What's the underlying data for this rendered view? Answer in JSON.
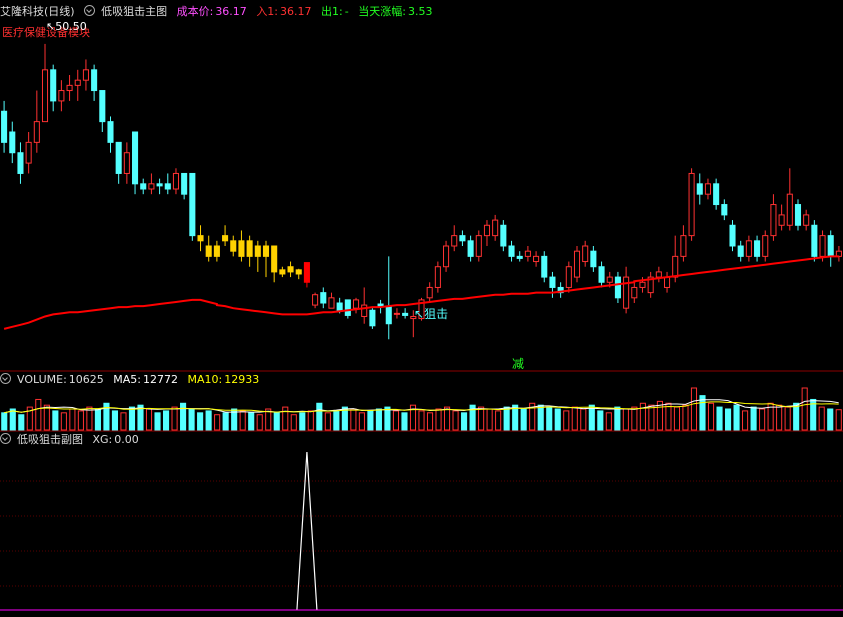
{
  "main_header": {
    "stock_name": "艾隆科技",
    "period": "(日线)",
    "indicator": "低吸狙击主图",
    "cost_label": "成本价:",
    "cost_value": "36.17",
    "in_label": "入1:",
    "in_value": "36.17",
    "out_label": "出1:",
    "out_value": "-",
    "change_label": "当天涨幅:",
    "change_value": "3.53"
  },
  "sector_label": "医疗保健设备模块",
  "high_marker": "50.50",
  "signal_label": "狙击",
  "reduce_label": "减",
  "volume_header": {
    "name": "VOLUME:",
    "value": "10625",
    "ma5_label": "MA5:",
    "ma5": "12772",
    "ma10_label": "MA10:",
    "ma10": "12933"
  },
  "sub_header": {
    "name": "低吸狙击副图",
    "xg_label": "XG:",
    "xg_value": "0.00"
  },
  "colors": {
    "up": "#ff3232",
    "down": "#54ffff",
    "ma_line": "#ff0000",
    "signal_yellow": "#ffd200",
    "signal_bar": "#ff0000",
    "ma5": "#ffffff",
    "ma10": "#ffff00",
    "xg": "#ffffff"
  },
  "chart_data": {
    "type": "candlestick",
    "candles": [
      {
        "o": 44,
        "c": 41,
        "h": 45,
        "l": 40
      },
      {
        "o": 42,
        "c": 40,
        "h": 43,
        "l": 39
      },
      {
        "o": 40,
        "c": 38,
        "h": 41,
        "l": 37
      },
      {
        "o": 39,
        "c": 41,
        "h": 42,
        "l": 38
      },
      {
        "o": 41,
        "c": 43,
        "h": 46,
        "l": 40
      },
      {
        "o": 43,
        "c": 48,
        "h": 50.5,
        "l": 43
      },
      {
        "o": 48,
        "c": 45,
        "h": 48.5,
        "l": 44
      },
      {
        "o": 45,
        "c": 46,
        "h": 47,
        "l": 44
      },
      {
        "o": 46,
        "c": 46.5,
        "h": 47.5,
        "l": 45
      },
      {
        "o": 46.5,
        "c": 47,
        "h": 48,
        "l": 45
      },
      {
        "o": 47,
        "c": 48,
        "h": 49,
        "l": 46
      },
      {
        "o": 48,
        "c": 46,
        "h": 48.5,
        "l": 45
      },
      {
        "o": 46,
        "c": 43,
        "h": 46,
        "l": 42
      },
      {
        "o": 43,
        "c": 41,
        "h": 43.5,
        "l": 40
      },
      {
        "o": 41,
        "c": 38,
        "h": 41,
        "l": 37
      },
      {
        "o": 38,
        "c": 40,
        "h": 41,
        "l": 37
      },
      {
        "o": 42,
        "c": 37,
        "h": 42,
        "l": 36
      },
      {
        "o": 37,
        "c": 36.5,
        "h": 37.5,
        "l": 36
      },
      {
        "o": 36.5,
        "c": 37,
        "h": 38,
        "l": 36
      },
      {
        "o": 37,
        "c": 36.8,
        "h": 37.5,
        "l": 36
      },
      {
        "o": 37,
        "c": 36.5,
        "h": 38,
        "l": 36
      },
      {
        "o": 36.5,
        "c": 38,
        "h": 38.5,
        "l": 36
      },
      {
        "o": 38,
        "c": 36,
        "h": 38,
        "l": 35.5
      },
      {
        "o": 38,
        "c": 32,
        "h": 38,
        "l": 31.5
      },
      {
        "o": 32,
        "c": 31.5,
        "h": 33,
        "l": 30.5
      },
      {
        "o": 31,
        "c": 30,
        "h": 32,
        "l": 29.5
      },
      {
        "o": 30,
        "c": 31,
        "h": 31.5,
        "l": 29.5
      },
      {
        "o": 32,
        "c": 31.5,
        "h": 33,
        "l": 31
      },
      {
        "o": 31.5,
        "c": 30.5,
        "h": 32,
        "l": 30
      },
      {
        "o": 30,
        "c": 31.5,
        "h": 32.5,
        "l": 29.5
      },
      {
        "o": 31.5,
        "c": 30,
        "h": 32,
        "l": 29
      },
      {
        "o": 30,
        "c": 31,
        "h": 31.5,
        "l": 28.5
      },
      {
        "o": 30,
        "c": 31,
        "h": 31.5,
        "l": 28
      },
      {
        "o": 31,
        "c": 28.5,
        "h": 31,
        "l": 27.5
      },
      {
        "o": 28.3,
        "c": 28.7,
        "h": 29,
        "l": 28
      },
      {
        "o": 28.5,
        "c": 29,
        "h": 29.5,
        "l": 28
      },
      {
        "o": 28.7,
        "c": 28.3,
        "h": 28.8,
        "l": 27.8
      },
      {
        "o": 27.5,
        "c": 29.4,
        "h": 29.4,
        "l": 27
      },
      {
        "o": 25.3,
        "c": 26.3,
        "h": 26.5,
        "l": 25
      },
      {
        "o": 26.5,
        "c": 25.5,
        "h": 27,
        "l": 25
      },
      {
        "o": 25,
        "c": 26,
        "h": 26.5,
        "l": 25
      },
      {
        "o": 25.5,
        "c": 24.7,
        "h": 26,
        "l": 24.5
      },
      {
        "o": 25.8,
        "c": 24.3,
        "h": 25.8,
        "l": 24
      },
      {
        "o": 25,
        "c": 25.8,
        "h": 26,
        "l": 24.5
      },
      {
        "o": 24.2,
        "c": 25.3,
        "h": 27,
        "l": 23.5
      },
      {
        "o": 24.8,
        "c": 23.3,
        "h": 25,
        "l": 23
      },
      {
        "o": 25.4,
        "c": 25.2,
        "h": 25.8,
        "l": 24.5
      },
      {
        "o": 25.2,
        "c": 23.5,
        "h": 30,
        "l": 22
      },
      {
        "o": 24.5,
        "c": 24.5,
        "h": 25,
        "l": 24
      },
      {
        "o": 24.5,
        "c": 24.3,
        "h": 25,
        "l": 24
      },
      {
        "o": 24,
        "c": 24.2,
        "h": 24.8,
        "l": 22.2
      },
      {
        "o": 24,
        "c": 25.8,
        "h": 26,
        "l": 23.8
      },
      {
        "o": 26,
        "c": 27,
        "h": 27.5,
        "l": 25.5
      },
      {
        "o": 27,
        "c": 29,
        "h": 29.5,
        "l": 26.5
      },
      {
        "o": 29,
        "c": 31,
        "h": 31.5,
        "l": 28.5
      },
      {
        "o": 31,
        "c": 32,
        "h": 33,
        "l": 30.5
      },
      {
        "o": 32,
        "c": 31.5,
        "h": 32.5,
        "l": 31
      },
      {
        "o": 31.5,
        "c": 30,
        "h": 32,
        "l": 29.5
      },
      {
        "o": 30,
        "c": 32,
        "h": 32.5,
        "l": 29.5
      },
      {
        "o": 32,
        "c": 33,
        "h": 33.5,
        "l": 31
      },
      {
        "o": 32,
        "c": 33.5,
        "h": 34,
        "l": 31.5
      },
      {
        "o": 33,
        "c": 31,
        "h": 33.5,
        "l": 30.5
      },
      {
        "o": 31,
        "c": 30,
        "h": 31.5,
        "l": 29.5
      },
      {
        "o": 30,
        "c": 29.8,
        "h": 30.5,
        "l": 29.5
      },
      {
        "o": 30,
        "c": 30.5,
        "h": 31,
        "l": 29.5
      },
      {
        "o": 29.5,
        "c": 30,
        "h": 30.5,
        "l": 29
      },
      {
        "o": 30,
        "c": 28,
        "h": 30.5,
        "l": 27.5
      },
      {
        "o": 28,
        "c": 27,
        "h": 28.5,
        "l": 26
      },
      {
        "o": 27,
        "c": 26.5,
        "h": 27.5,
        "l": 26
      },
      {
        "o": 27,
        "c": 29,
        "h": 29.5,
        "l": 26.5
      },
      {
        "o": 28,
        "c": 30.5,
        "h": 31,
        "l": 27.5
      },
      {
        "o": 29.5,
        "c": 31,
        "h": 31.5,
        "l": 29
      },
      {
        "o": 30.5,
        "c": 29,
        "h": 31,
        "l": 28.5
      },
      {
        "o": 29,
        "c": 27.5,
        "h": 29.5,
        "l": 27
      },
      {
        "o": 27.5,
        "c": 28,
        "h": 28.5,
        "l": 27
      },
      {
        "o": 28,
        "c": 26,
        "h": 28.5,
        "l": 25.5
      },
      {
        "o": 25,
        "c": 28,
        "h": 29,
        "l": 24.5
      },
      {
        "o": 26,
        "c": 27,
        "h": 27.5,
        "l": 25.5
      },
      {
        "o": 27,
        "c": 27.5,
        "h": 28,
        "l": 26.5
      },
      {
        "o": 26.5,
        "c": 28,
        "h": 28.5,
        "l": 26
      },
      {
        "o": 28,
        "c": 28.5,
        "h": 29,
        "l": 27.5
      },
      {
        "o": 27,
        "c": 28,
        "h": 28.5,
        "l": 26.5
      },
      {
        "o": 28,
        "c": 30,
        "h": 32,
        "l": 27.5
      },
      {
        "o": 30,
        "c": 32,
        "h": 33,
        "l": 29.5
      },
      {
        "o": 32,
        "c": 38,
        "h": 38.5,
        "l": 31.5
      },
      {
        "o": 37,
        "c": 36,
        "h": 38,
        "l": 35
      },
      {
        "o": 36,
        "c": 37,
        "h": 37.5,
        "l": 35.5
      },
      {
        "o": 37,
        "c": 35,
        "h": 37.5,
        "l": 34.5
      },
      {
        "o": 35,
        "c": 34,
        "h": 35.5,
        "l": 33.5
      },
      {
        "o": 33,
        "c": 31,
        "h": 33.5,
        "l": 30.5
      },
      {
        "o": 31,
        "c": 30,
        "h": 31.5,
        "l": 29.5
      },
      {
        "o": 30,
        "c": 31.5,
        "h": 32,
        "l": 29.5
      },
      {
        "o": 31.5,
        "c": 30,
        "h": 32,
        "l": 29.5
      },
      {
        "o": 30,
        "c": 32,
        "h": 32.5,
        "l": 29.5
      },
      {
        "o": 32,
        "c": 35,
        "h": 36,
        "l": 31.5
      },
      {
        "o": 33,
        "c": 34,
        "h": 35,
        "l": 32.5
      },
      {
        "o": 33,
        "c": 36,
        "h": 38.5,
        "l": 32.5
      },
      {
        "o": 35,
        "c": 33,
        "h": 35.5,
        "l": 32.5
      },
      {
        "o": 33,
        "c": 34,
        "h": 34.5,
        "l": 32.5
      },
      {
        "o": 33,
        "c": 30,
        "h": 33.5,
        "l": 29.5
      },
      {
        "o": 30,
        "c": 32,
        "h": 32.5,
        "l": 29.5
      },
      {
        "o": 32,
        "c": 30,
        "h": 32.5,
        "l": 29
      },
      {
        "o": 30,
        "c": 30.5,
        "h": 31,
        "l": 29.5
      }
    ],
    "signal_candles": [
      24,
      25,
      26,
      27,
      28,
      29,
      30,
      31,
      32,
      33,
      34,
      35,
      36
    ],
    "buy_signal_index": 37,
    "ma_line": [
      23.0,
      23.2,
      23.4,
      23.6,
      23.9,
      24.2,
      24.4,
      24.5,
      24.6,
      24.6,
      24.7,
      24.8,
      24.9,
      25.0,
      25.1,
      25.1,
      25.2,
      25.2,
      25.3,
      25.4,
      25.5,
      25.6,
      25.7,
      25.8,
      25.8,
      25.6,
      25.4,
      25.3,
      25.2,
      25.0,
      24.9,
      24.8,
      24.7,
      24.6,
      24.5,
      24.4,
      24.4,
      24.4,
      24.4,
      24.5,
      24.6,
      24.6,
      24.7,
      24.8,
      24.9,
      25.0,
      25.1,
      25.1,
      25.2,
      25.3,
      25.3,
      25.4,
      25.5,
      25.6,
      25.7,
      25.8,
      25.9,
      25.9,
      26.0,
      26.1,
      26.2,
      26.3,
      26.3,
      26.4,
      26.4,
      26.4,
      26.5,
      26.5,
      26.5,
      26.6,
      26.7,
      26.8,
      26.9,
      27.0,
      27.1,
      27.2,
      27.3,
      27.4,
      27.5,
      27.6,
      27.7,
      27.8,
      27.9,
      28.0,
      28.1,
      28.2,
      28.3,
      28.4,
      28.5,
      28.6,
      28.7,
      28.8,
      28.9,
      29.0,
      29.1,
      29.2,
      29.3,
      29.4,
      29.5,
      29.6,
      29.7,
      29.8,
      29.9,
      30.0,
      30.0
    ],
    "volume": [
      9000,
      11000,
      8000,
      12000,
      16000,
      13000,
      10000,
      9000,
      11000,
      10000,
      12000,
      11000,
      14000,
      10000,
      9000,
      12000,
      13000,
      11000,
      9000,
      10000,
      12000,
      14000,
      11000,
      9000,
      10000,
      8000,
      9000,
      11000,
      10000,
      9000,
      8000,
      11000,
      9000,
      12000,
      8000,
      9000,
      10000,
      14000,
      9000,
      10000,
      12000,
      11000,
      9000,
      10000,
      11000,
      12000,
      10000,
      9000,
      13000,
      10000,
      9000,
      11000,
      12000,
      10000,
      9000,
      13000,
      12000,
      11000,
      10000,
      12000,
      13000,
      11000,
      14000,
      13000,
      12000,
      11000,
      10000,
      12000,
      11000,
      13000,
      10000,
      9000,
      12000,
      11000,
      12000,
      14000,
      13000,
      15000,
      14000,
      12000,
      13000,
      22000,
      18000,
      14000,
      12000,
      11000,
      13000,
      10000,
      12000,
      11000,
      14000,
      13000,
      12000,
      14000,
      22000,
      16000,
      12000,
      11000,
      10625
    ],
    "vol_ma5": [
      12772
    ],
    "vol_ma10": [
      12933
    ],
    "xg": [
      {
        "index": 37,
        "value": 1
      }
    ]
  }
}
